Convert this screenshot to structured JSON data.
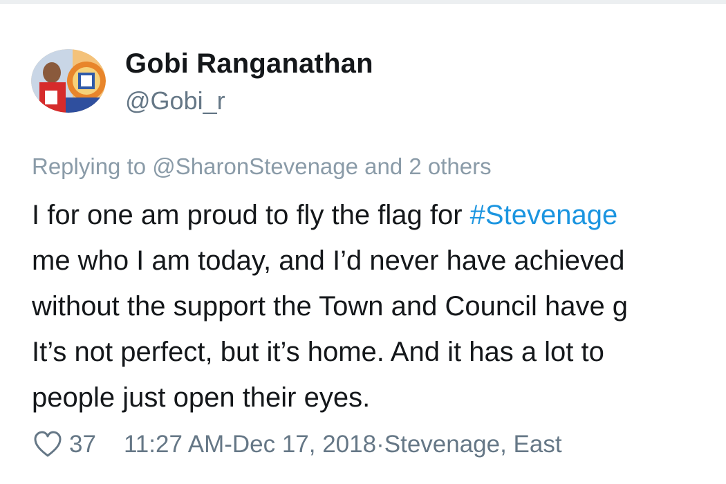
{
  "tweet": {
    "author": {
      "display_name": "Gobi Ranganathan",
      "handle": "@Gobi_r",
      "avatar_icon": "profile-photo"
    },
    "reply_context": {
      "prefix": "Replying to ",
      "mention": "@SharonStevenage",
      "suffix": " and 2 others"
    },
    "body_lines": [
      {
        "before": "I for one am proud to fly the flag for ",
        "hashtag": "#Stevenage",
        "after": ""
      },
      {
        "before": "me who I am today, and I’d never have achieved",
        "hashtag": "",
        "after": ""
      },
      {
        "before": "without the support the Town and Council have g",
        "hashtag": "",
        "after": ""
      },
      {
        "before": "It’s not perfect, but it’s home. And it has a lot to",
        "hashtag": "",
        "after": ""
      },
      {
        "before": "people just open their eyes.",
        "hashtag": "",
        "after": ""
      }
    ],
    "meta": {
      "like_icon": "heart-icon",
      "like_count": "37",
      "time": "11:27 AM",
      "separator": " - ",
      "date": "Dec 17, 2018",
      "dot": " · ",
      "location": "Stevenage, East"
    },
    "colors": {
      "text": "#14171a",
      "secondary": "#657786",
      "hashtag": "#1b95e0"
    }
  }
}
